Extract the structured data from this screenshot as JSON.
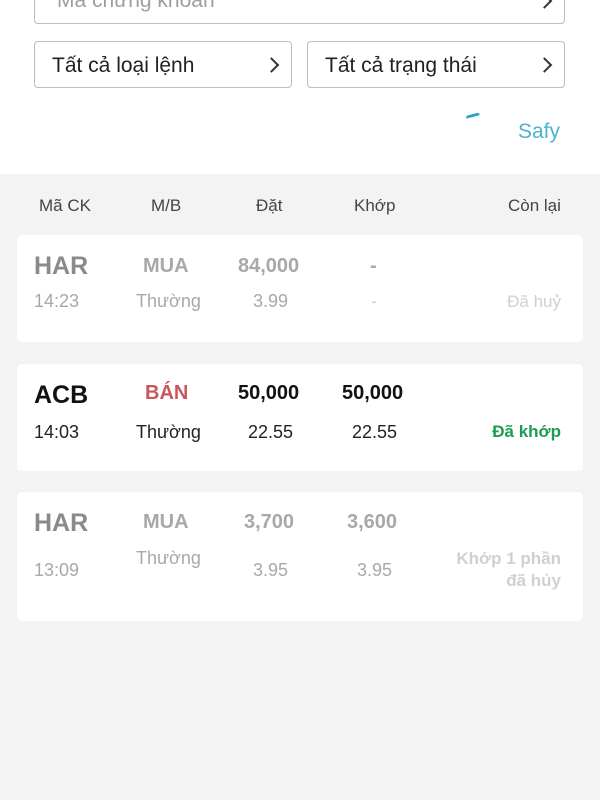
{
  "filters": {
    "search_placeholder": "Mã chứng khoán",
    "order_type": "Tất cả loại lệnh",
    "order_status": "Tất cả trạng thái"
  },
  "brand": {
    "label": "Safy"
  },
  "table": {
    "headers": {
      "symbol": "Mã CK",
      "side": "M/B",
      "placed": "Đặt",
      "matched": "Khớp",
      "remaining": "Còn lại"
    },
    "orders": [
      {
        "symbol": "HAR",
        "side": "MUA",
        "placed_qty": "84,000",
        "matched_qty": "-",
        "time": "14:23",
        "order_type": "Thường",
        "placed_price": "3.99",
        "matched_price": "-",
        "status": "Đã huỷ",
        "status_color": "#d0d0d0"
      },
      {
        "symbol": "ACB",
        "side": "BÁN",
        "placed_qty": "50,000",
        "matched_qty": "50,000",
        "time": "14:03",
        "order_type": "Thường",
        "placed_price": "22.55",
        "matched_price": "22.55",
        "status": "Đã khớp",
        "status_color": "#1a9d53"
      },
      {
        "symbol": "HAR",
        "side": "MUA",
        "placed_qty": "3,700",
        "matched_qty": "3,600",
        "time": "13:09",
        "order_type": "Thường",
        "placed_price": "3.95",
        "matched_price": "3.95",
        "status_line1": "Khớp 1 phần",
        "status_line2": "đã hủy",
        "status_color": "#d0d0d0"
      }
    ]
  },
  "colors": {
    "accent": "#4ab3d3",
    "sell": "#c8575d",
    "matched": "#1a9d53"
  }
}
